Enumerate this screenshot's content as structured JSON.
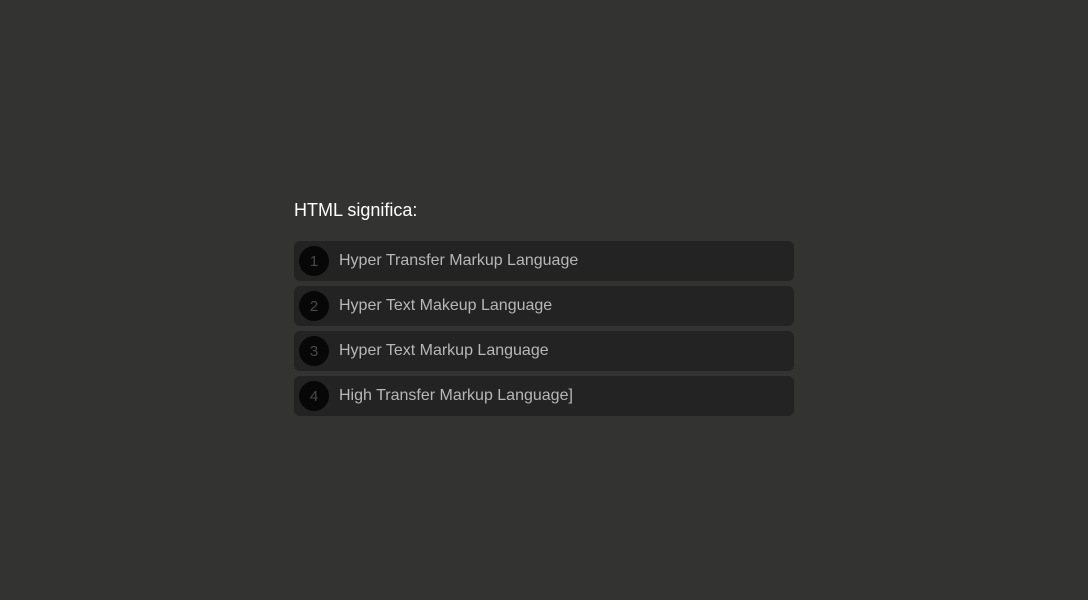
{
  "quiz": {
    "question": "HTML significa:",
    "options": [
      {
        "number": "1",
        "text": "Hyper Transfer Markup Language"
      },
      {
        "number": "2",
        "text": "Hyper Text Makeup Language"
      },
      {
        "number": "3",
        "text": "Hyper Text Markup Language"
      },
      {
        "number": "4",
        "text": "High Transfer Markup Language]"
      }
    ]
  },
  "colors": {
    "background": "#333331",
    "option_background": "#232323",
    "number_circle": "#070707",
    "question_text": "#ffffff",
    "option_text": "#b7b7b7"
  }
}
